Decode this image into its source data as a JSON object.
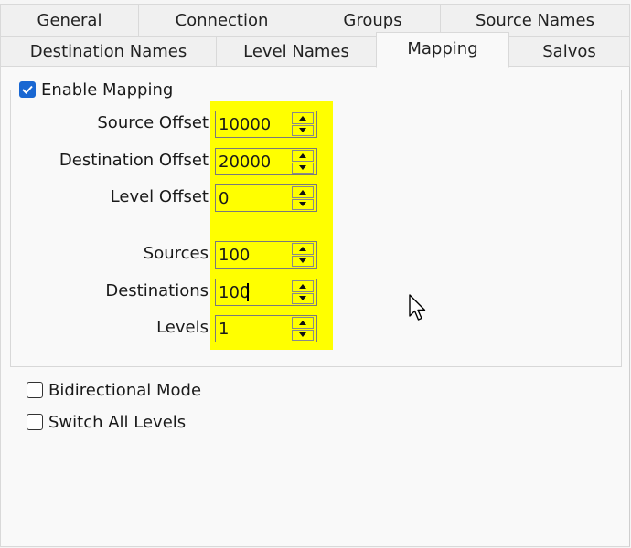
{
  "tabs_row1": [
    {
      "label": "General"
    },
    {
      "label": "Connection"
    },
    {
      "label": "Groups"
    },
    {
      "label": "Source Names"
    }
  ],
  "tabs_row2": [
    {
      "label": "Destination Names"
    },
    {
      "label": "Level Names"
    },
    {
      "label": "Mapping"
    },
    {
      "label": "Salvos"
    }
  ],
  "active_tab": "Mapping",
  "enable_mapping": {
    "label": "Enable Mapping",
    "checked": true
  },
  "fields": [
    {
      "label": "Source Offset",
      "value": "10000"
    },
    {
      "label": "Destination Offset",
      "value": "20000"
    },
    {
      "label": "Level Offset",
      "value": "0"
    },
    {
      "label": "Sources",
      "value": "100"
    },
    {
      "label": "Destinations",
      "value": "100"
    },
    {
      "label": "Levels",
      "value": "1"
    }
  ],
  "bidirectional_mode": {
    "label": "Bidirectional Mode",
    "checked": false
  },
  "switch_all_levels": {
    "label": "Switch All Levels",
    "checked": false
  },
  "colors": {
    "highlight": "#ffff00",
    "checkbox_accent": "#1967d2"
  }
}
